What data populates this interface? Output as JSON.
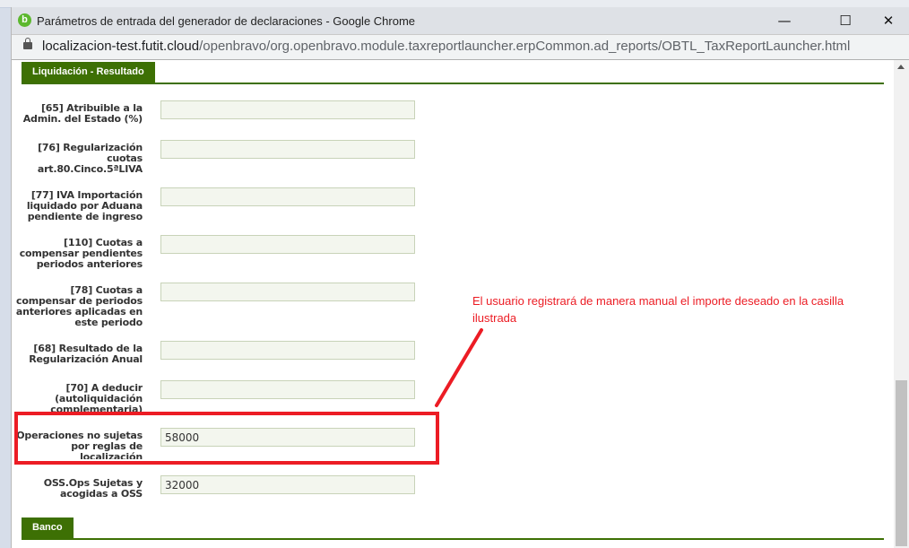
{
  "window": {
    "title": "Parámetros de entrada del generador de declaraciones - Google Chrome",
    "logo": "b",
    "url_host": "localizacion-test.futit.cloud",
    "url_path": "/openbravo/org.openbravo.module.taxreportlauncher.erpCommon.ad_reports/OBTL_TaxReportLauncher.html",
    "minimize": "—",
    "maximize": "☐",
    "close": "✕"
  },
  "sections": {
    "liquidacion": "Liquidación - Resultado",
    "banco": "Banco"
  },
  "fields": [
    {
      "label": "[65] Atribuible a la Admin. del Estado (%)",
      "value": ""
    },
    {
      "label": "[76] Regularización cuotas art.80.Cinco.5ªLIVA",
      "value": ""
    },
    {
      "label": "[77] IVA Importación liquidado por Aduana pendiente de ingreso",
      "value": ""
    },
    {
      "label": "[110] Cuotas a compensar pendientes periodos anteriores",
      "value": ""
    },
    {
      "label": "[78] Cuotas a compensar de periodos anteriores aplicadas en este periodo",
      "value": ""
    },
    {
      "label": "[68] Resultado de la Regularización Anual",
      "value": ""
    },
    {
      "label": "[70] A deducir (autoliquidación complementaria)",
      "value": ""
    },
    {
      "label": "Operaciones no sujetas por reglas de localización",
      "value": "58000"
    },
    {
      "label": "OSS.Ops Sujetas y acogidas a OSS",
      "value": "32000"
    }
  ],
  "annotation": "El usuario registrará de manera manual el importe deseado en la casilla ilustrada",
  "colors": {
    "brand_green": "#3d7004",
    "annotation_red": "#ec1c24"
  }
}
